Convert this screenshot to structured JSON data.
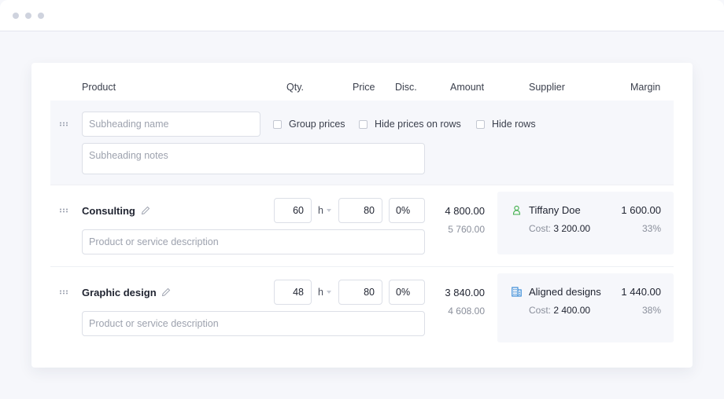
{
  "window": {
    "controls": [
      "dot",
      "dot",
      "dot"
    ]
  },
  "columns": {
    "product": "Product",
    "qty": "Qty.",
    "price": "Price",
    "disc": "Disc.",
    "amount": "Amount",
    "supplier": "Supplier",
    "margin": "Margin"
  },
  "subheading": {
    "name_placeholder": "Subheading name",
    "notes_placeholder": "Subheading notes",
    "options": [
      {
        "label": "Group prices",
        "checked": false
      },
      {
        "label": "Hide prices on rows",
        "checked": false
      },
      {
        "label": "Hide rows",
        "checked": false
      }
    ]
  },
  "rows": [
    {
      "name": "Consulting",
      "description_placeholder": "Product or service description",
      "qty": "60",
      "unit": "h",
      "price": "80",
      "discount": "0%",
      "amount": "4 800.00",
      "amount_secondary": "5 760.00",
      "supplier": {
        "icon": "person-icon",
        "icon_color": "#3fae4a",
        "name": "Tiffany Doe",
        "margin": "1 600.00",
        "cost_label": "Cost:",
        "cost": "3 200.00",
        "margin_pct": "33%"
      }
    },
    {
      "name": "Graphic design",
      "description_placeholder": "Product or service description",
      "qty": "48",
      "unit": "h",
      "price": "80",
      "discount": "0%",
      "amount": "3 840.00",
      "amount_secondary": "4 608.00",
      "supplier": {
        "icon": "building-icon",
        "icon_color": "#2f86d6",
        "name": "Aligned designs",
        "margin": "1 440.00",
        "cost_label": "Cost:",
        "cost": "2 400.00",
        "margin_pct": "38%"
      }
    }
  ]
}
